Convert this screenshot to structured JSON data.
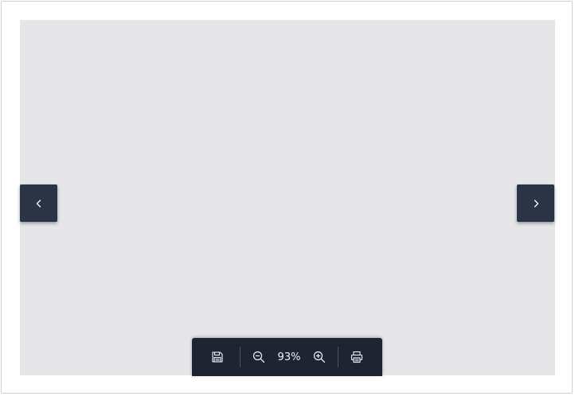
{
  "navigation": {
    "prev_icon": "chevron-left-icon",
    "next_icon": "chevron-right-icon"
  },
  "toolbar": {
    "save_icon": "save-icon",
    "zoom_out_icon": "zoom-out-icon",
    "zoom_level": "93%",
    "zoom_in_icon": "zoom-in-icon",
    "print_icon": "print-icon"
  },
  "colors": {
    "viewer_background": "#e6e6e8",
    "nav_button": "#2a3446",
    "toolbar": "#1f2433",
    "icon": "#f2f2f2"
  }
}
